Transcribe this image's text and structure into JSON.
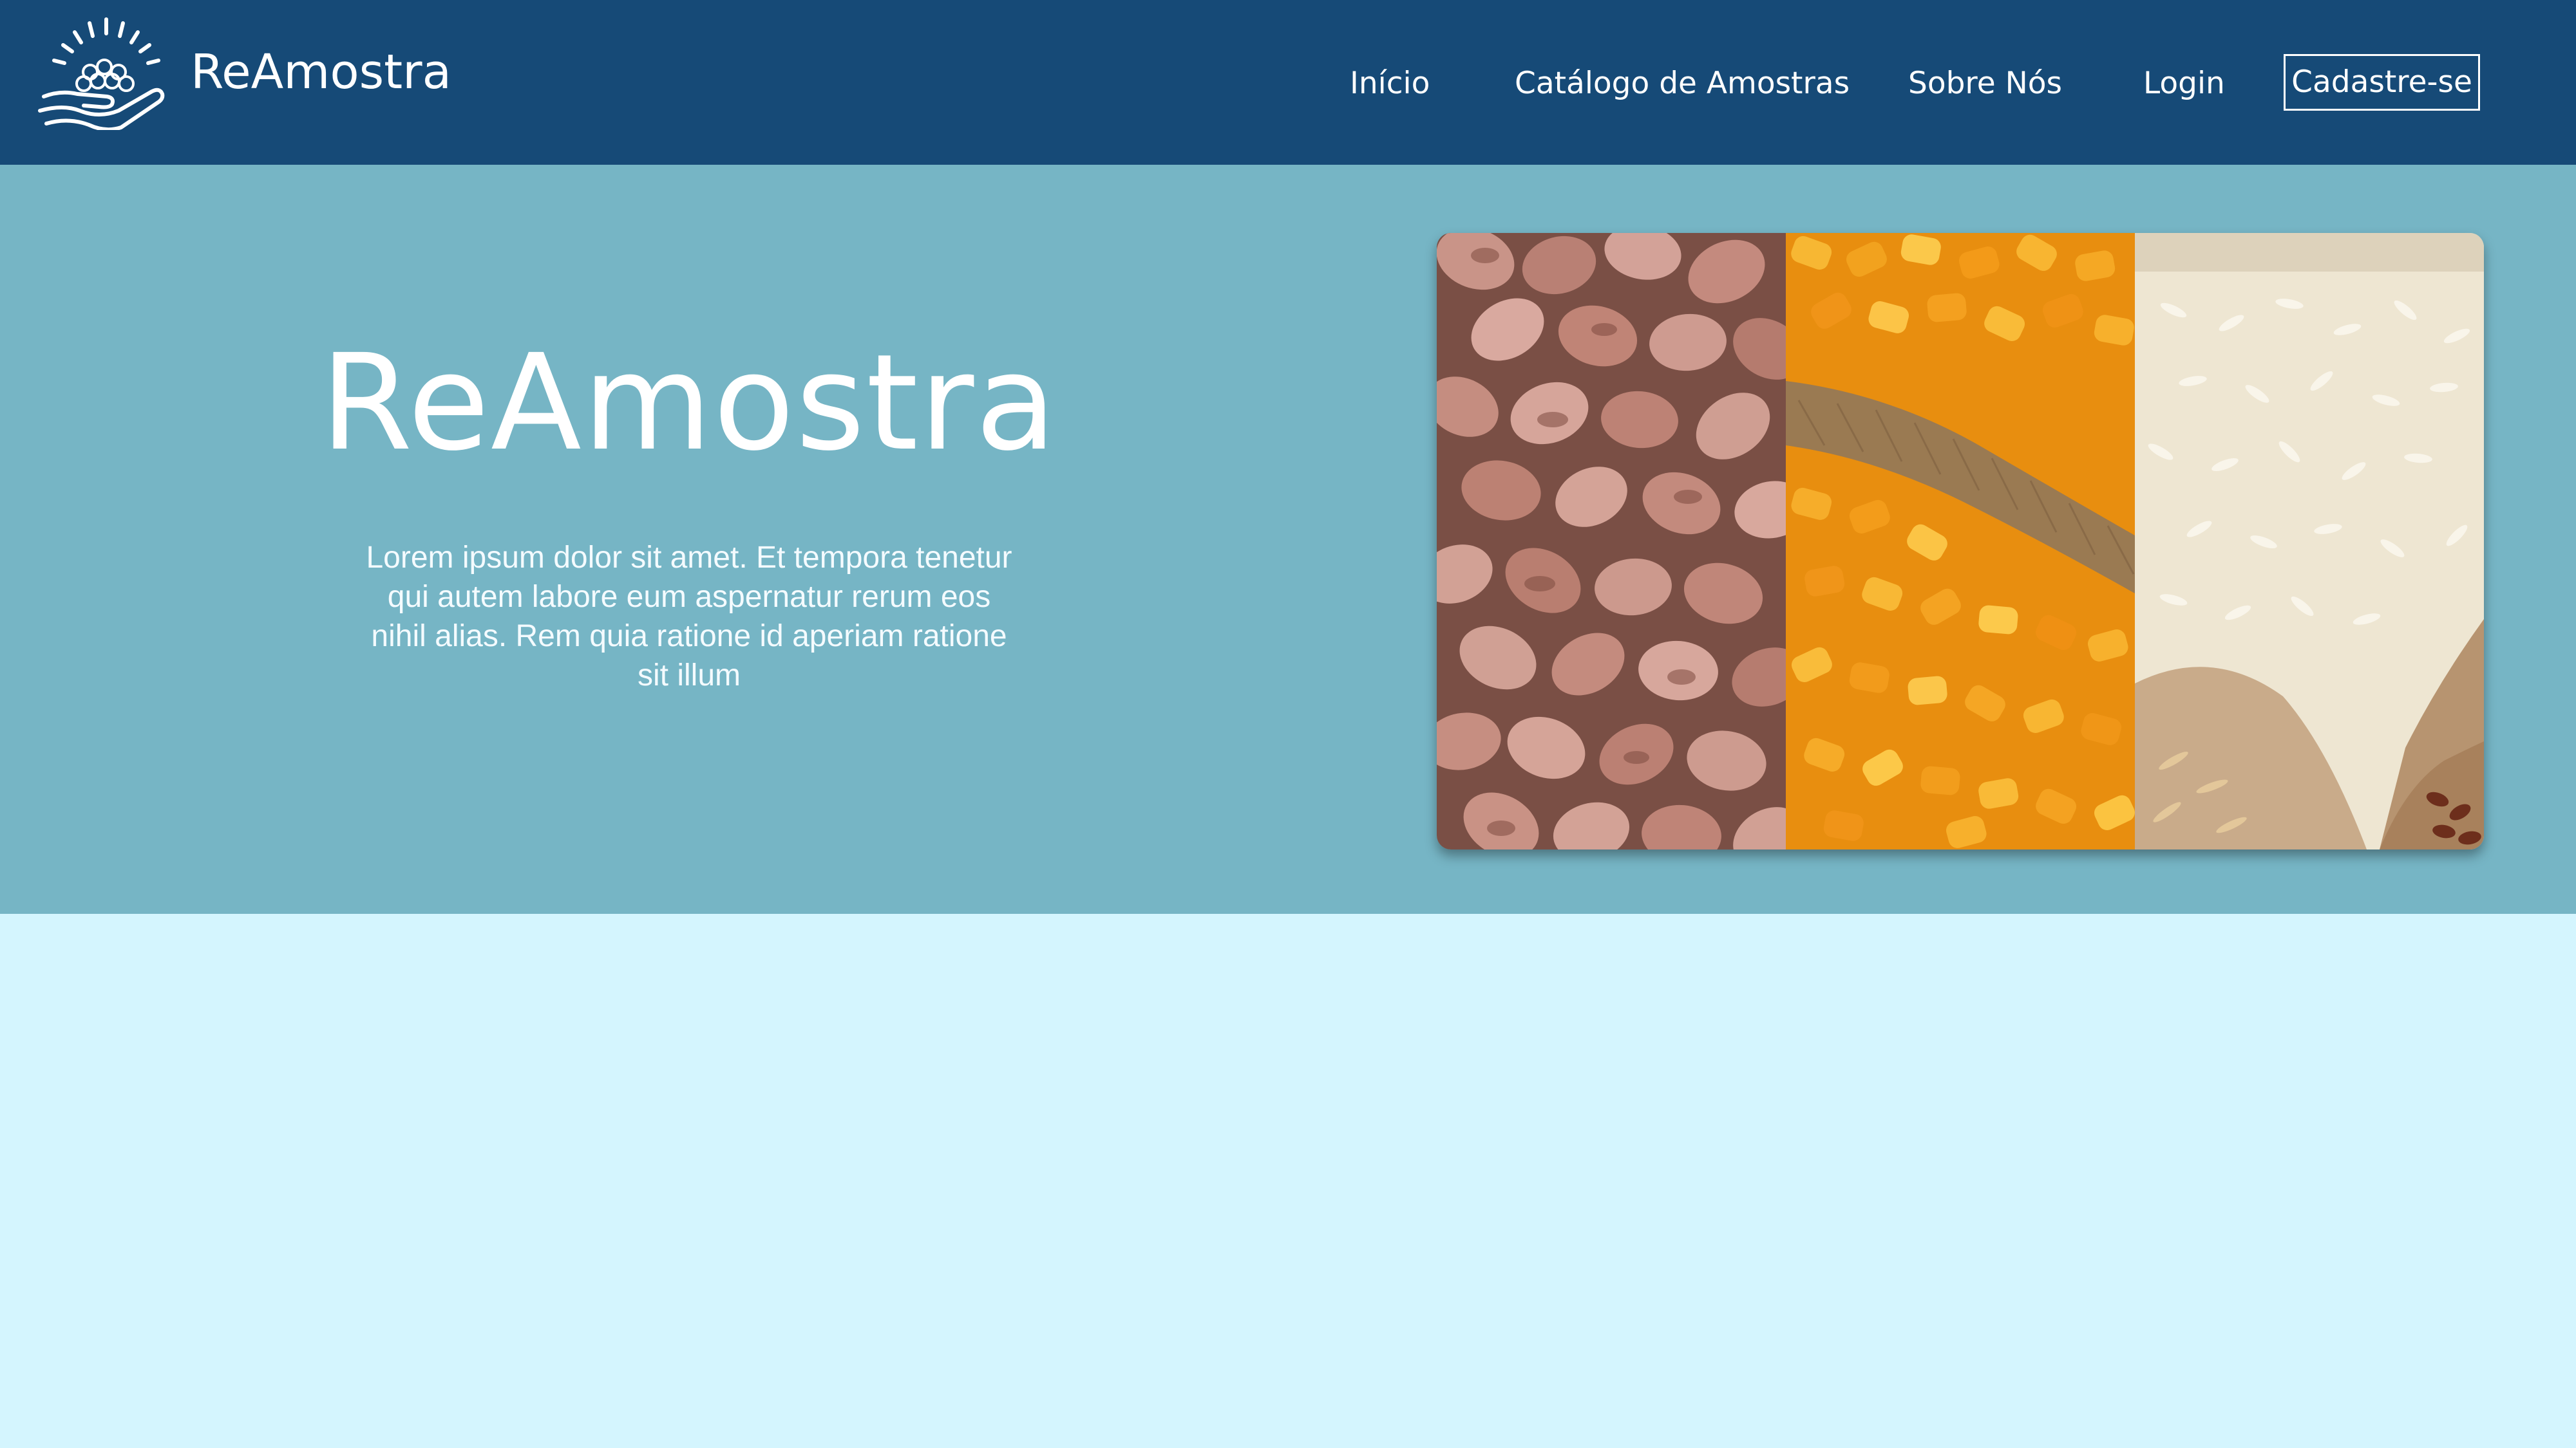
{
  "header": {
    "brand_name": "ReAmostra",
    "logo_icon": "hand-with-seeds-and-sunrise-icon",
    "nav": {
      "inicio": "Início",
      "catalogo": "Catálogo de Amostras",
      "sobre": "Sobre Nós",
      "login": "Login",
      "cadastro": "Cadastre-se"
    }
  },
  "hero": {
    "title": "ReAmostra",
    "description": "Lorem ipsum dolor sit amet. Et tempora tenetur qui autem labore eum aspernatur rerum eos nihil alias. Rem quia ratione id aperiam ratione sit illum",
    "gallery": [
      {
        "subject": "beans-photo"
      },
      {
        "subject": "corn-photo"
      },
      {
        "subject": "rice-photo"
      }
    ]
  },
  "colors": {
    "header_bg": "#164a77",
    "hero_bg": "#76b5c5",
    "page_bg": "#d4f5fe",
    "text": "#ffffff"
  }
}
